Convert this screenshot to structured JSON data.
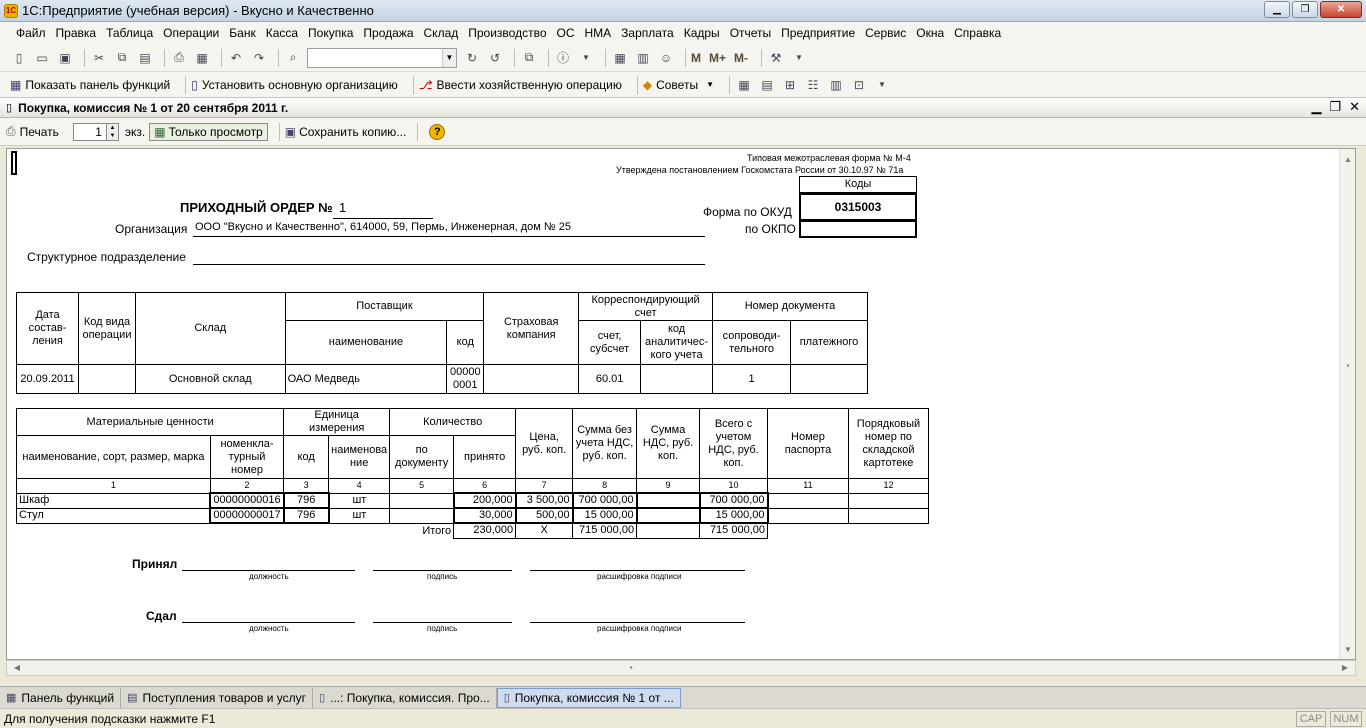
{
  "window": {
    "title": "1С:Предприятие (учебная версия) - Вкусно и Качественно",
    "logo": "1С"
  },
  "menu": [
    "Файл",
    "Правка",
    "Таблица",
    "Операции",
    "Банк",
    "Касса",
    "Покупка",
    "Продажа",
    "Склад",
    "Производство",
    "ОС",
    "НМА",
    "Зарплата",
    "Кадры",
    "Отчеты",
    "Предприятие",
    "Сервис",
    "Окна",
    "Справка"
  ],
  "toolbar1": {
    "m": "M",
    "mplus": "M+",
    "mminus": "M-"
  },
  "toolbar2": {
    "show_panel": "Показать панель функций",
    "set_org": "Установить основную организацию",
    "enter_op": "Ввести хозяйственную операцию",
    "tips": "Советы"
  },
  "doc": {
    "title": "Покупка, комиссия № 1 от 20 сентября 2011 г."
  },
  "doc_toolbar": {
    "print": "Печать",
    "copies": "1",
    "copies_unit": "экз.",
    "view_only": "Только просмотр",
    "save_copy": "Сохранить копию...",
    "help": "?"
  },
  "form": {
    "form_line1": "Типовая межотраслевая форма № М-4",
    "form_line2": "Утверждена постановлением Госкомстата России от 30.10.97 № 71а",
    "codes": "Коды",
    "okud_label": "Форма по ОКУД",
    "okud": "0315003",
    "okpo_label": "по ОКПО",
    "order_title": "ПРИХОДНЫЙ ОРДЕР №",
    "order_num": "1",
    "org_label": "Организация",
    "org_value": "ООО \"Вкусно и Качественно\", 614000, 59, Пермь, Инженерная, дом № 25",
    "subdiv_label": "Структурное подразделение"
  },
  "t1": {
    "h_date": "Дата состав-ления",
    "h_optype": "Код вида операции",
    "h_warehouse": "Склад",
    "h_supplier": "Поставщик",
    "h_name": "наименование",
    "h_code": "код",
    "h_insurance": "Страховая компания",
    "h_corr": "Корреспондирующий счет",
    "h_account": "счет, субсчет",
    "h_analytic": "код аналитичес-кого учета",
    "h_docnum": "Номер документа",
    "h_accomp": "сопроводи-тельного",
    "h_payment": "платежного",
    "date": "20.09.2011",
    "optype": "",
    "warehouse": "Основной склад",
    "supplier": "ОАО Медведь",
    "supplier_code_1": "00000",
    "supplier_code_2": "0001",
    "insurance": "",
    "account": "60.01",
    "analytic": "",
    "accomp": "1",
    "payment": ""
  },
  "t2": {
    "h_material": "Материальные ценности",
    "h_unit": "Единица измерения",
    "h_qty": "Количество",
    "h_name": "наименование, сорт, размер, марка",
    "h_nomnum": "номенкла-турный номер",
    "h_code": "код",
    "h_unitname": "наименова ние",
    "h_bydoc": "по документу",
    "h_accepted": "принято",
    "h_price": "Цена, руб. коп.",
    "h_sum_novat": "Сумма без учета НДС, руб. коп.",
    "h_vat": "Сумма НДС, руб. коп.",
    "h_total": "Всего с учетом НДС, руб. коп.",
    "h_passport": "Номер паспорта",
    "h_cardnum": "Порядковый номер по складской картотеке",
    "colnums": [
      "1",
      "2",
      "3",
      "4",
      "5",
      "6",
      "7",
      "8",
      "9",
      "10",
      "11",
      "12"
    ],
    "rows": [
      {
        "name": "Шкаф",
        "nom": "00000000016",
        "code": "796",
        "unit": "шт",
        "bydoc": "",
        "accepted": "200,000",
        "price": "3 500,00",
        "sum": "700 000,00",
        "vat": "",
        "total": "700 000,00",
        "passport": "",
        "card": ""
      },
      {
        "name": "Стул",
        "nom": "00000000017",
        "code": "796",
        "unit": "шт",
        "bydoc": "",
        "accepted": "30,000",
        "price": "500,00",
        "sum": "15 000,00",
        "vat": "",
        "total": "15 000,00",
        "passport": "",
        "card": ""
      }
    ],
    "itogo_label": "Итого",
    "itogo_qty": "230,000",
    "itogo_price": "X",
    "itogo_sum": "715 000,00",
    "itogo_vat": "",
    "itogo_total": "715 000,00"
  },
  "sign": {
    "accepted": "Принял",
    "handed": "Сдал",
    "position": "должность",
    "signature": "подпись",
    "decoding": "расшифровка подписи"
  },
  "taskbar": [
    "Панель функций",
    "Поступления товаров и услуг",
    "...: Покупка, комиссия. Про...",
    "Покупка, комиссия № 1 от ..."
  ],
  "status": {
    "hint": "Для получения подсказки нажмите F1",
    "cap": "CAP",
    "num": "NUM"
  }
}
